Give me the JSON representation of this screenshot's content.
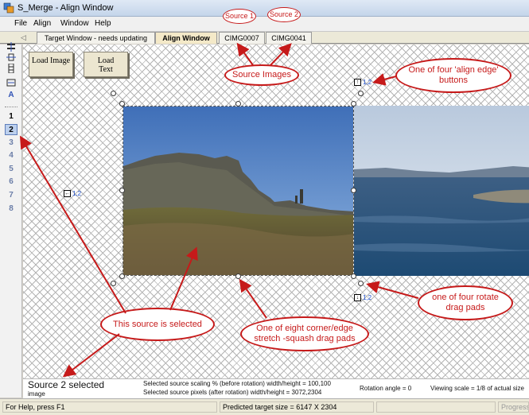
{
  "window": {
    "title": "S_Merge - Align Window"
  },
  "menu": {
    "items": [
      "File",
      "Align",
      "Window",
      "Help"
    ]
  },
  "tabs": [
    {
      "label": "Target Window - needs updating",
      "active": false
    },
    {
      "label": "Align Window",
      "active": true
    },
    {
      "label": "CIMG0007",
      "active": false
    },
    {
      "label": "CIMG0041",
      "active": false
    }
  ],
  "sidebar": {
    "tools": [
      "align-horizontal-icon",
      "align-center-icon",
      "align-vertical-icon",
      "fit-width-icon",
      "text-icon"
    ],
    "text_tool_label": "A",
    "numbers": [
      "1",
      "2",
      "3",
      "4",
      "5",
      "6",
      "7",
      "8"
    ],
    "selected_number": "2"
  },
  "toolbar": {
    "load_image": "Load Image",
    "load_text": "Text"
  },
  "toolbar_load_text_prefix": "Load",
  "align_buttons": {
    "label": "1,2"
  },
  "status_panel": {
    "selected": "Source 2 selected",
    "type": "image",
    "scaling": "Selected source scaling % (before rotation) width/height = 100,100",
    "pixels": "Selected source pixels (after rotation) width/height = 3072,2304",
    "rotation": "Rotation angle = 0",
    "viewing_scale": "Viewing scale = 1/8 of actual size"
  },
  "status_bar": {
    "help": "For Help, press F1",
    "target_size": "Predicted target size = 6147 X 2304",
    "progress": "Progress"
  },
  "annotations": {
    "source1": "Source 1",
    "source2": "Source 2",
    "source_images": "Source Images",
    "align_edge": "One of four 'align edge' buttons",
    "rotate": "one of four rotate drag pads",
    "selected": "This source is selected",
    "stretch": "One of eight corner/edge stretch -squash drag pads"
  },
  "colors": {
    "annotation_red": "#c61a1a",
    "active_tab": "#f4e9c8",
    "selected_number_bg": "#bcd0ee"
  }
}
